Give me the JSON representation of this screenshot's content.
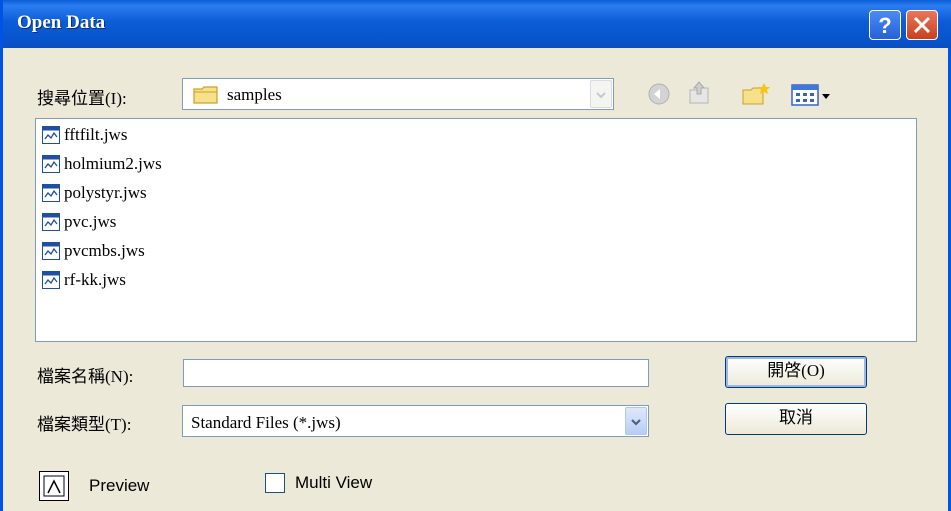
{
  "window": {
    "title": "Open Data",
    "help_icon": "help-icon",
    "close_icon": "close-icon"
  },
  "location": {
    "label": "搜尋位置(I):",
    "value": "samples",
    "folder_icon": "folder-icon",
    "toolbar_icons": [
      "back-icon",
      "up-folder-icon",
      "new-folder-icon",
      "view-menu-icon"
    ]
  },
  "files": [
    {
      "name": "fftfilt.jws",
      "icon": "jws-file-icon"
    },
    {
      "name": "holmium2.jws",
      "icon": "jws-file-icon"
    },
    {
      "name": "polystyr.jws",
      "icon": "jws-file-icon"
    },
    {
      "name": "pvc.jws",
      "icon": "jws-file-icon"
    },
    {
      "name": "pvcmbs.jws",
      "icon": "jws-file-icon"
    },
    {
      "name": "rf-kk.jws",
      "icon": "jws-file-icon"
    }
  ],
  "filename": {
    "label": "檔案名稱(N):",
    "value": ""
  },
  "filetype": {
    "label": "檔案類型(T):",
    "value": "Standard Files (*.jws)"
  },
  "buttons": {
    "open": "開啓(O)",
    "cancel": "取消"
  },
  "preview": {
    "label": "Preview"
  },
  "multiview": {
    "label": "Multi View",
    "checked": false
  },
  "colors": {
    "titlebar": "#0a5fd8",
    "dialog_bg": "#ece9d8",
    "border": "#7f9db9"
  }
}
